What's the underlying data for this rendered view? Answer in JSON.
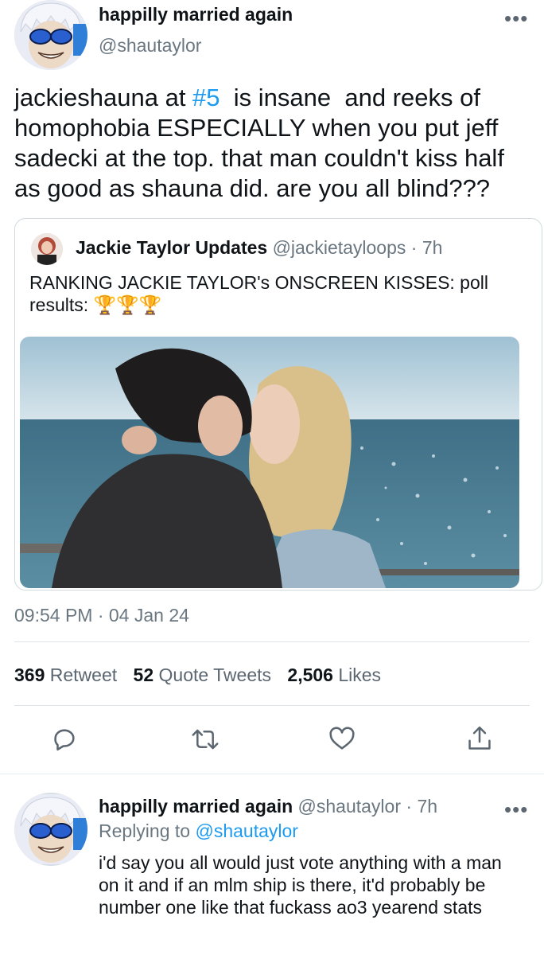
{
  "tweet": {
    "display_name": "happilly married again",
    "handle": "@shautaylor",
    "text_before": "jackieshauna at ",
    "hashtag": "#5",
    "text_after": "  is insane  and reeks of homophobia ESPECIALLY when you put jeff sadecki at the top. that man couldn't kiss half as good as shauna did. are you all blind???",
    "timestamp": "09:54 PM · 04 Jan 24",
    "stats": {
      "retweets": "369",
      "retweets_label": "Retweet",
      "quotes": "52",
      "quotes_label": "Quote Tweets",
      "likes": "2,506",
      "likes_label": "Likes"
    }
  },
  "quoted_tweet": {
    "display_name": "Jackie Taylor Updates",
    "handle": "@jackietayloops",
    "age": "· 7h",
    "text": "RANKING JACKIE TAYLOR's ONSCREEN KISSES: poll results:",
    "emoji": "🏆🏆🏆"
  },
  "actions": {
    "reply_icon": "reply-icon",
    "retweet_icon": "retweet-icon",
    "like_icon": "heart-icon",
    "share_icon": "share-icon"
  },
  "reply": {
    "display_name": "happilly married again",
    "handle": "@shautaylor",
    "age": "· 7h",
    "replying_label": "Replying to",
    "replying_handle": "@shautaylor",
    "text": "i'd say you all would just vote anything with a man on it and if an mlm ship is there, it'd probably be number one like that fuckass ao3 yearend stats"
  },
  "colors": {
    "accent": "#1d9bf0",
    "muted": "#6a7781",
    "divider": "#dfe4e8"
  }
}
